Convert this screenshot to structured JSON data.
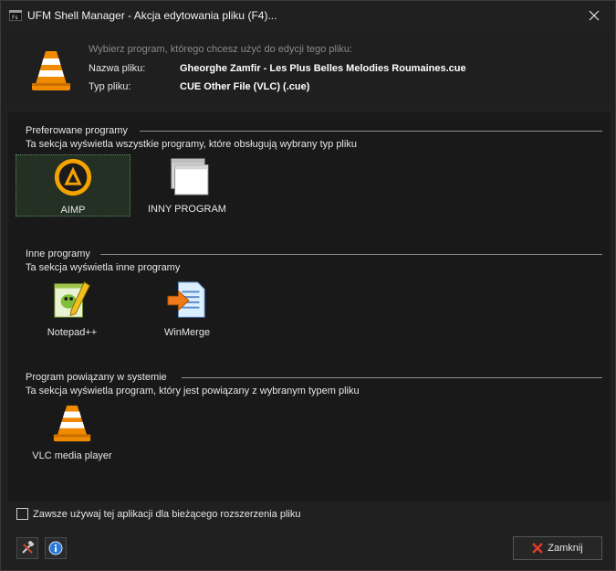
{
  "window": {
    "title": "UFM Shell Manager - Akcja edytowania pliku (F4)...",
    "close_glyph": "close-icon"
  },
  "header": {
    "hint": "Wybierz program, którego chcesz użyć do edycji tego pliku:",
    "file_name_label": "Nazwa pliku:",
    "file_name_value": "Gheorghe Zamfir - Les Plus Belles Melodies Roumaines.cue",
    "file_type_label": "Typ pliku:",
    "file_type_value": "CUE Other File (VLC) (.cue)",
    "icon": "vlc-cone-icon"
  },
  "sections": {
    "preferred": {
      "title": "Preferowane programy",
      "desc": "Ta sekcja wyświetla wszystkie programy, które obsługują wybrany typ pliku",
      "items": [
        {
          "label": "AIMP",
          "icon": "aimp-icon",
          "selected": true
        },
        {
          "label": "INNY PROGRAM",
          "icon": "windows-app-icon",
          "selected": false
        }
      ]
    },
    "other": {
      "title": "Inne programy",
      "desc": "Ta sekcja wyświetla inne programy",
      "items": [
        {
          "label": "Notepad++",
          "icon": "notepad-plus-plus-icon"
        },
        {
          "label": "WinMerge",
          "icon": "winmerge-icon"
        }
      ]
    },
    "system": {
      "title": "Program powiązany w systemie",
      "desc": "Ta sekcja wyświetla program, który jest powiązany z wybranym typem pliku",
      "items": [
        {
          "label": "VLC media player",
          "icon": "vlc-cone-icon"
        }
      ]
    }
  },
  "footer": {
    "always_use_label": "Zawsze używaj tej aplikacji dla bieżącego rozszerzenia pliku",
    "always_use_checked": false,
    "close_label": "Zamknij"
  },
  "colors": {
    "background": "#1f1f1f",
    "content": "#191919",
    "vlc_orange": "#f08a00",
    "aimp_orange": "#f5a300",
    "selection_border": "#5a8a5a"
  }
}
